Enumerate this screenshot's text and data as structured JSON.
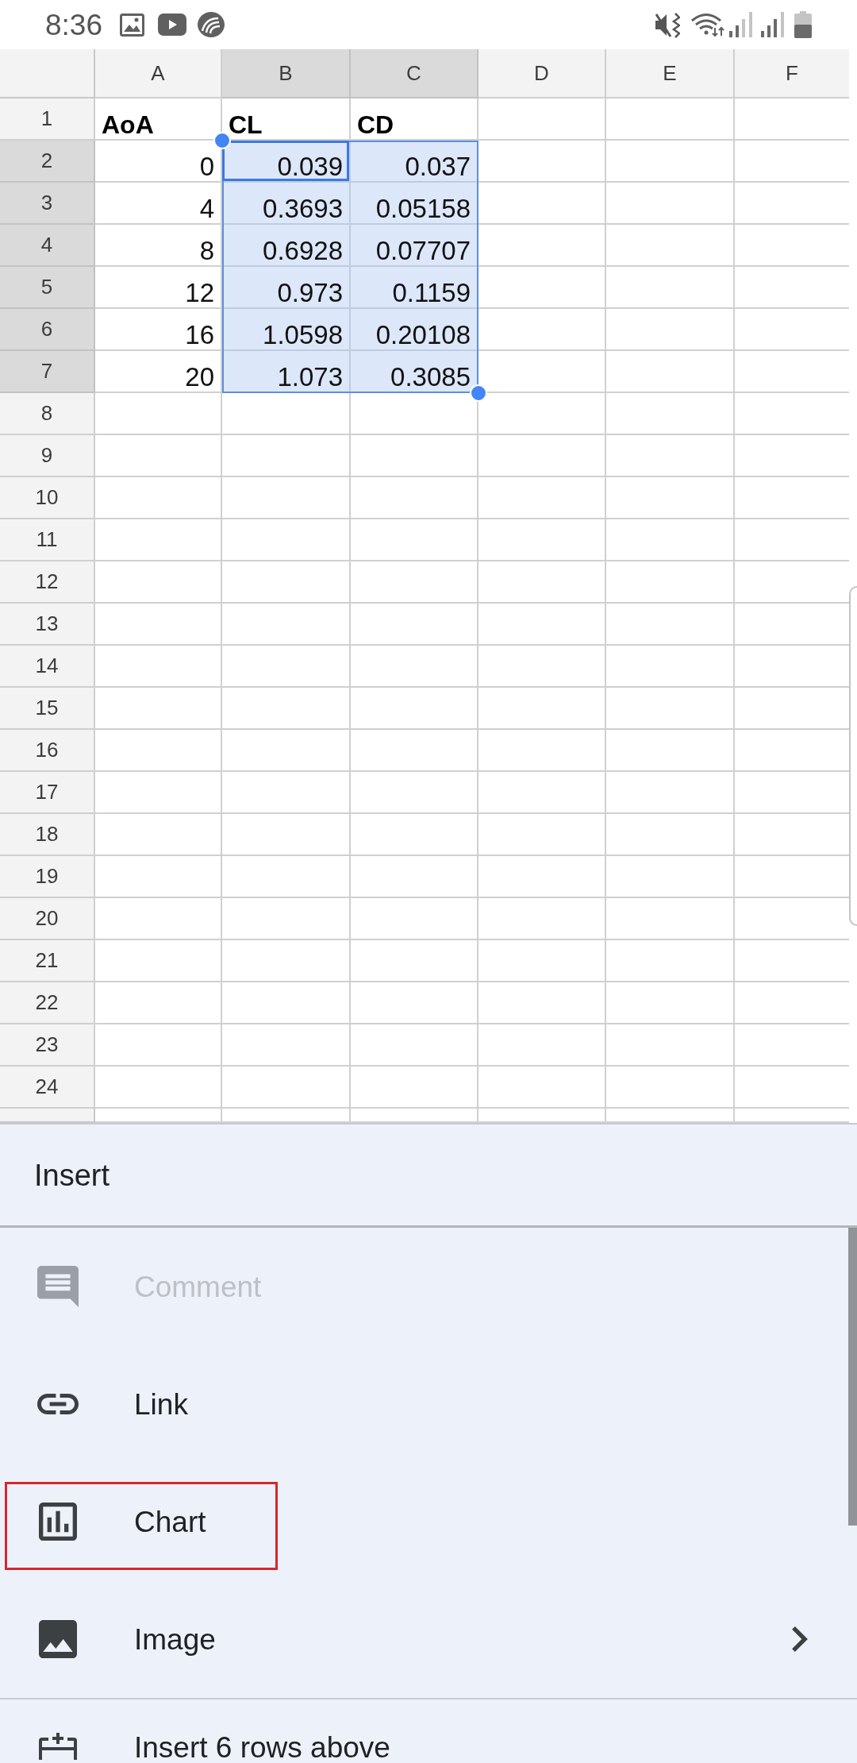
{
  "status_bar": {
    "time": "8:36"
  },
  "spreadsheet": {
    "columns": [
      {
        "label": "A",
        "selected": false
      },
      {
        "label": "B",
        "selected": true
      },
      {
        "label": "C",
        "selected": true
      },
      {
        "label": "D",
        "selected": false
      },
      {
        "label": "E",
        "selected": false
      },
      {
        "label": "F",
        "selected": false
      }
    ],
    "rows": [
      {
        "label": "1",
        "selected": false,
        "cells": [
          {
            "value": "AoA",
            "kind": "label",
            "selected": false,
            "active": false
          },
          {
            "value": "CL",
            "kind": "label",
            "selected": false,
            "active": false
          },
          {
            "value": "CD",
            "kind": "label",
            "selected": false,
            "active": false
          }
        ]
      },
      {
        "label": "2",
        "selected": true,
        "cells": [
          {
            "value": "0",
            "kind": "number",
            "selected": false,
            "active": false
          },
          {
            "value": "0.039",
            "kind": "number",
            "selected": true,
            "active": true
          },
          {
            "value": "0.037",
            "kind": "number",
            "selected": true,
            "active": false
          }
        ]
      },
      {
        "label": "3",
        "selected": true,
        "cells": [
          {
            "value": "4",
            "kind": "number",
            "selected": false,
            "active": false
          },
          {
            "value": "0.3693",
            "kind": "number",
            "selected": true,
            "active": false
          },
          {
            "value": "0.05158",
            "kind": "number",
            "selected": true,
            "active": false
          }
        ]
      },
      {
        "label": "4",
        "selected": true,
        "cells": [
          {
            "value": "8",
            "kind": "number",
            "selected": false,
            "active": false
          },
          {
            "value": "0.6928",
            "kind": "number",
            "selected": true,
            "active": false
          },
          {
            "value": "0.07707",
            "kind": "number",
            "selected": true,
            "active": false
          }
        ]
      },
      {
        "label": "5",
        "selected": true,
        "cells": [
          {
            "value": "12",
            "kind": "number",
            "selected": false,
            "active": false
          },
          {
            "value": "0.973",
            "kind": "number",
            "selected": true,
            "active": false
          },
          {
            "value": "0.1159",
            "kind": "number",
            "selected": true,
            "active": false
          }
        ]
      },
      {
        "label": "6",
        "selected": true,
        "cells": [
          {
            "value": "16",
            "kind": "number",
            "selected": false,
            "active": false
          },
          {
            "value": "1.0598",
            "kind": "number",
            "selected": true,
            "active": false
          },
          {
            "value": "0.20108",
            "kind": "number",
            "selected": true,
            "active": false
          }
        ]
      },
      {
        "label": "7",
        "selected": true,
        "cells": [
          {
            "value": "20",
            "kind": "number",
            "selected": false,
            "active": false
          },
          {
            "value": "1.073",
            "kind": "number",
            "selected": true,
            "active": false
          },
          {
            "value": "0.3085",
            "kind": "number",
            "selected": true,
            "active": false
          }
        ]
      },
      {
        "label": "8",
        "selected": false
      },
      {
        "label": "9",
        "selected": false
      },
      {
        "label": "10",
        "selected": false
      },
      {
        "label": "11",
        "selected": false
      },
      {
        "label": "12",
        "selected": false
      },
      {
        "label": "13",
        "selected": false
      },
      {
        "label": "14",
        "selected": false
      },
      {
        "label": "15",
        "selected": false
      },
      {
        "label": "16",
        "selected": false
      },
      {
        "label": "17",
        "selected": false
      },
      {
        "label": "18",
        "selected": false
      },
      {
        "label": "19",
        "selected": false
      },
      {
        "label": "20",
        "selected": false
      },
      {
        "label": "21",
        "selected": false
      },
      {
        "label": "22",
        "selected": false
      },
      {
        "label": "23",
        "selected": false
      },
      {
        "label": "24",
        "selected": false
      }
    ]
  },
  "insert_menu": {
    "title": "Insert",
    "sections": [
      {
        "items": [
          {
            "label": "Comment",
            "kind": "comment",
            "disabled": true,
            "highlighted": false,
            "submenu": false
          },
          {
            "label": "Link",
            "kind": "link",
            "disabled": false,
            "highlighted": false,
            "submenu": false
          },
          {
            "label": "Chart",
            "kind": "chart",
            "disabled": false,
            "highlighted": true,
            "submenu": false
          },
          {
            "label": "Image",
            "kind": "image",
            "disabled": false,
            "highlighted": false,
            "submenu": true
          }
        ]
      },
      {
        "items": [
          {
            "label": "Insert 6 rows above",
            "kind": "insert_rows",
            "disabled": false,
            "highlighted": false,
            "submenu": false
          }
        ]
      }
    ]
  }
}
